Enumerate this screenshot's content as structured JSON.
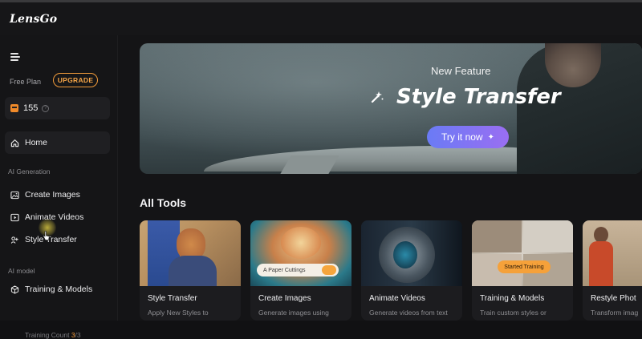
{
  "app": {
    "logo": "LensGo"
  },
  "sidebar": {
    "plan": {
      "label": "Free Plan",
      "upgrade": "UPGRADE"
    },
    "credits": "155",
    "home": "Home",
    "section_generation": "AI Generation",
    "items": [
      {
        "label": "Create Images",
        "icon": "image-icon"
      },
      {
        "label": "Animate Videos",
        "icon": "video-play-icon"
      },
      {
        "label": "Style Transfer",
        "icon": "style-transfer-icon"
      }
    ],
    "section_model": "AI model",
    "training": {
      "label": "Training & Models",
      "count_label": "Training Count",
      "count_used": "3",
      "count_total": "/3"
    }
  },
  "hero": {
    "tag": "New Feature",
    "title": "Style Transfer",
    "button": "Try it now"
  },
  "tools": {
    "heading": "All Tools",
    "cards": [
      {
        "name": "Style Transfer",
        "desc": "Apply New Styles to"
      },
      {
        "name": "Create Images",
        "desc": "Generate images using",
        "prompt": "A Paper Cuttings"
      },
      {
        "name": "Animate Videos",
        "desc": "Generate videos from text"
      },
      {
        "name": "Training & Models",
        "desc": "Train custom styles or",
        "badge": "Started Training"
      },
      {
        "name": "Restyle Phot",
        "desc": "Transform imag"
      }
    ]
  },
  "colors": {
    "accent_orange": "#f09a3a",
    "button_gradient_start": "#6a7bf5",
    "button_gradient_end": "#9a6ef2"
  }
}
